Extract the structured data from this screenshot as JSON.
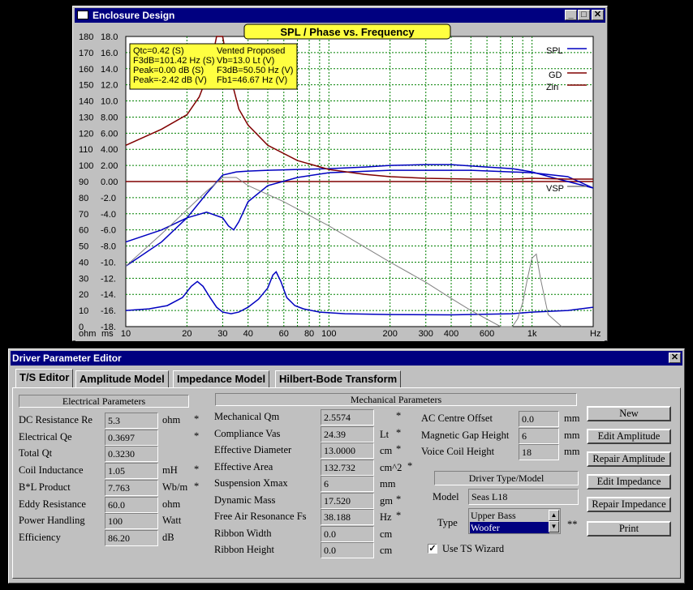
{
  "enclosure": {
    "title": "Enclosure Design",
    "chart_title": "SPL / Phase vs. Frequency",
    "info": {
      "l1a": "Qtc=0.42 (S)",
      "l1b": "Vented Proposed",
      "l2a": "F3dB=101.42 Hz (S)",
      "l2b": "Vb=13.0 Lt (V)",
      "l3a": "Peak=0.00 dB (S)",
      "l3b": "F3dB=50.50 Hz (V)",
      "l4a": "Peak=-2.42 dB (V)",
      "l4b": "Fb1=46.67 Hz (V)"
    },
    "legend": {
      "spl": "SPL",
      "gd": "GD",
      "zin": "Zin",
      "vsp": "VSP"
    },
    "axis_ohm": [
      "180",
      "170",
      "160",
      "150",
      "140",
      "130",
      "120",
      "110",
      "100",
      "90",
      "80",
      "70",
      "60",
      "50",
      "40",
      "30",
      "20",
      "10",
      "0"
    ],
    "axis_ms": [
      "18.0",
      "16.0",
      "14.0",
      "12.0",
      "10.0",
      "8.00",
      "6.00",
      "4.00",
      "2.00",
      "0.00",
      "-2.0",
      "-4.0",
      "-6.0",
      "-8.0",
      "-10.",
      "-12.",
      "-14.",
      "-16.",
      "-18."
    ],
    "x_ticks": [
      {
        "label": "10",
        "f": 10
      },
      {
        "label": "20",
        "f": 20
      },
      {
        "label": "30",
        "f": 30
      },
      {
        "label": "40",
        "f": 40
      },
      {
        "label": "60",
        "f": 60
      },
      {
        "label": "80",
        "f": 80
      },
      {
        "label": "100",
        "f": 100
      },
      {
        "label": "200",
        "f": 200
      },
      {
        "label": "300",
        "f": 300
      },
      {
        "label": "400",
        "f": 400
      },
      {
        "label": "600",
        "f": 600
      },
      {
        "label": "1k",
        "f": 1000
      }
    ],
    "unit_ohm": "ohm",
    "unit_ms": "ms",
    "unit_hz": "Hz"
  },
  "chart_data": {
    "type": "line",
    "x_scale": "log",
    "xlim": [
      10,
      2000
    ],
    "ylim_left": [
      0,
      180
    ],
    "ylim_right": [
      -18,
      18
    ],
    "grid": true,
    "legend_position": "top-right",
    "colors": {
      "spl": "#0000c0",
      "gd": "#800000",
      "zin": "#800000",
      "spl2": "#0000c0",
      "vsp": "#808080"
    },
    "series": [
      {
        "name": "SPL",
        "axis": "ms",
        "x": [
          10,
          15,
          20,
          25,
          30,
          35,
          40,
          50,
          70,
          100,
          150,
          200,
          300,
          400,
          600,
          800,
          1000,
          1300,
          2000
        ],
        "y": [
          -10.5,
          -7.5,
          -4.5,
          -1.5,
          0.8,
          1.2,
          1.3,
          1.4,
          1.5,
          1.6,
          1.8,
          2.0,
          2.1,
          2.1,
          1.8,
          1.6,
          1.2,
          0.4,
          -0.8
        ]
      },
      {
        "name": "",
        "axis": "ms",
        "x": [
          10,
          15,
          20,
          25,
          30,
          32,
          34,
          36,
          40,
          50,
          70,
          100,
          200,
          500,
          1000,
          1500,
          2000
        ],
        "y": [
          -7.5,
          -6,
          -4.5,
          -3.8,
          -4.5,
          -5.5,
          -6.0,
          -5,
          -2.5,
          -0.5,
          0.5,
          1.1,
          1.4,
          1.4,
          1.1,
          0.6,
          -0.8
        ]
      },
      {
        "name": "GD",
        "axis": "ms",
        "x": [
          10,
          15,
          20,
          23,
          26,
          28,
          30,
          32,
          36,
          40,
          50,
          70,
          100,
          150,
          200,
          300,
          500,
          800,
          1000,
          1500,
          2000
        ],
        "y": [
          4.5,
          6.5,
          8.3,
          10.5,
          14,
          18,
          18,
          14,
          9,
          7,
          4.5,
          2.6,
          1.5,
          0.9,
          0.6,
          0.4,
          0.3,
          0.3,
          0.4,
          0.3,
          0.3
        ]
      },
      {
        "name": "Zin",
        "axis": "ohm",
        "x": [
          10,
          13,
          16,
          19,
          21,
          22.5,
          24,
          26,
          28,
          30,
          33,
          36,
          40,
          45,
          50,
          53,
          55,
          58,
          62,
          68,
          75,
          90,
          120,
          200,
          400,
          800,
          1000,
          1500,
          2000
        ],
        "y": [
          10,
          11,
          13,
          18,
          25,
          28,
          25,
          18,
          12,
          9,
          8,
          9,
          12,
          17,
          24,
          32,
          34,
          28,
          18,
          13,
          11,
          9,
          8,
          7.5,
          7.3,
          8,
          9,
          10,
          12
        ]
      },
      {
        "name": "VSP",
        "axis": "ms",
        "x": [
          10,
          15,
          20,
          25,
          30,
          35,
          40,
          60,
          100,
          200,
          300,
          400,
          500,
          700,
          800,
          850,
          900,
          950,
          1000,
          1050,
          1100,
          1200,
          1400
        ],
        "y": [
          -10.5,
          -6.5,
          -3.5,
          -1.2,
          0.5,
          0.5,
          -0.5,
          -2.5,
          -5.5,
          -10,
          -12.5,
          -14.5,
          -16,
          -18,
          -18,
          -17,
          -15,
          -12,
          -9.5,
          -9,
          -12,
          -16.5,
          -18
        ]
      }
    ]
  },
  "editor": {
    "title": "Driver Parameter Editor",
    "tabs": [
      "T/S Editor",
      "Amplitude Model",
      "Impedance Model",
      "Hilbert-Bode Transform"
    ],
    "elec_header": "Electrical Parameters",
    "mech_header": "Mechanical Parameters",
    "electrical": [
      {
        "label": "DC Resistance Re",
        "value": "5.3",
        "unit": "ohm",
        "star": "*"
      },
      {
        "label": "Electrical Qe",
        "value": "0.3697",
        "unit": "",
        "star": "*"
      },
      {
        "label": "Total Qt",
        "value": "0.3230",
        "unit": "",
        "star": ""
      },
      {
        "label": "Coil Inductance",
        "value": "1.05",
        "unit": "mH",
        "star": "*"
      },
      {
        "label": "B*L Product",
        "value": "7.763",
        "unit": "Wb/m",
        "star": "*"
      },
      {
        "label": "Eddy Resistance",
        "value": "60.0",
        "unit": "ohm",
        "star": ""
      },
      {
        "label": "Power Handling",
        "value": "100",
        "unit": "Watt",
        "star": ""
      },
      {
        "label": "Efficiency",
        "value": "86.20",
        "unit": "dB",
        "star": ""
      }
    ],
    "mechanical": [
      {
        "label": "Mechanical Qm",
        "value": "2.5574",
        "unit": "",
        "star": "*"
      },
      {
        "label": "Compliance Vas",
        "value": "24.39",
        "unit": "Lt",
        "star": "*"
      },
      {
        "label": "Effective Diameter",
        "value": "13.0000",
        "unit": "cm",
        "star": "*"
      },
      {
        "label": "Effective Area",
        "value": "132.732",
        "unit": "cm^2",
        "star": "*"
      },
      {
        "label": "Suspension Xmax",
        "value": "6",
        "unit": "mm",
        "star": ""
      },
      {
        "label": "Dynamic Mass",
        "value": "17.520",
        "unit": "gm",
        "star": "*"
      },
      {
        "label": "Free Air Resonance Fs",
        "value": "38.188",
        "unit": "Hz",
        "star": "*"
      },
      {
        "label": "Ribbon Width",
        "value": "0.0",
        "unit": "cm",
        "star": ""
      },
      {
        "label": "Ribbon Height",
        "value": "0.0",
        "unit": "cm",
        "star": ""
      }
    ],
    "extra": [
      {
        "label": "AC Centre Offset",
        "value": "0.0",
        "unit": "mm"
      },
      {
        "label": "Magnetic Gap Height",
        "value": "6",
        "unit": "mm"
      },
      {
        "label": "Voice Coil Height",
        "value": "18",
        "unit": "mm"
      }
    ],
    "driver_type_header": "Driver Type/Model",
    "model_label": "Model",
    "model_value": "Seas L18",
    "type_label": "Type",
    "type_options": [
      "Upper Bass",
      "Woofer"
    ],
    "type_selected": "Woofer",
    "type_star": "**",
    "use_wizard": "Use TS Wizard",
    "use_wizard_checked": true,
    "buttons": [
      "New",
      "Edit Amplitude",
      "Repair Amplitude",
      "Edit Impedance",
      "Repair Impedance",
      "Print"
    ]
  }
}
